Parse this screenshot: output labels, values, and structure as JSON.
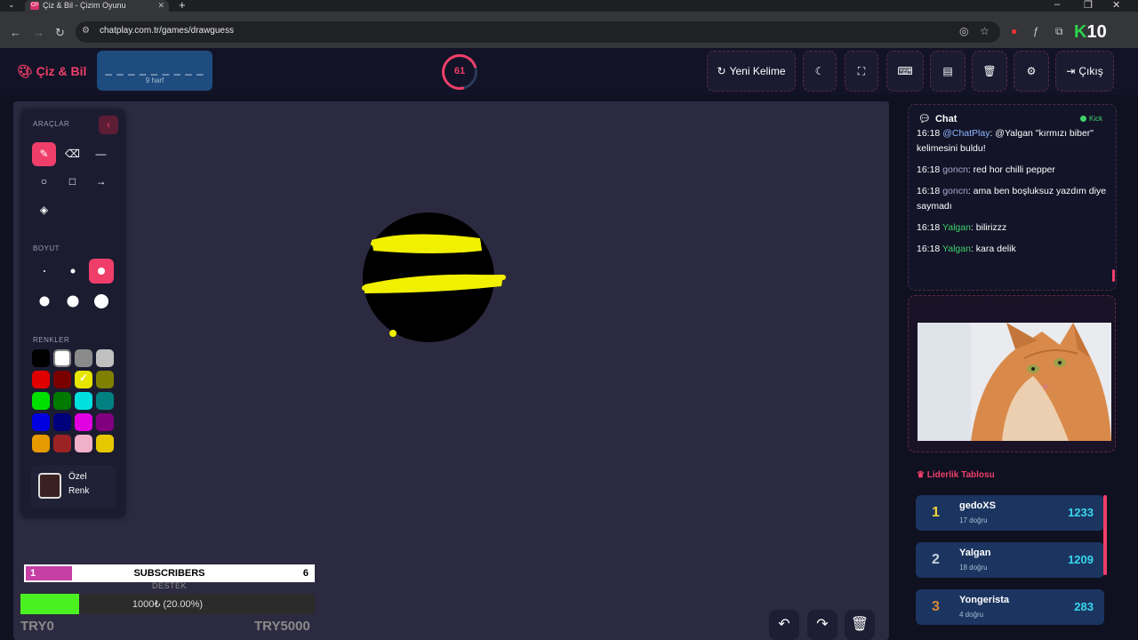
{
  "browser": {
    "tab_title": "Çiz & Bil - Çizim Oyunu",
    "tab_favicon": "CP",
    "url": "chatplay.com.tr/games/drawguess",
    "k10_label": "10",
    "k10_letter": "K"
  },
  "header": {
    "brand": "Çiz & Bil",
    "word_hint": "_ _ _ _ _ _ _ _ _",
    "letter_count": "9 harf",
    "timer": "61",
    "new_word_label": "Yeni Kelime",
    "exit_label": "Çıkış"
  },
  "tools": {
    "section_tools": "ARAÇLAR",
    "section_size": "BOYUT",
    "section_colors": "RENKLER",
    "custom_color_label": "Özel Renk",
    "colors": [
      "#000000",
      "#ffffff",
      "#8a8a8a",
      "#c0c0c0",
      "#e00000",
      "#7a0000",
      "#e6e600",
      "#808000",
      "#00e000",
      "#007a00",
      "#00e0e0",
      "#008080",
      "#0000e0",
      "#00007a",
      "#e000e0",
      "#800080",
      "#e69a00",
      "#9c2323",
      "#f0b0c8",
      "#e6c800"
    ],
    "selected_color": "#e6e600"
  },
  "overlay": {
    "subs_current": "1",
    "subs_label": "SUBSCRIBERS",
    "subs_target": "6",
    "subs_progress": 0.16,
    "destek_label": "DESTEK",
    "donation_text": "1000₺ (20.00%)",
    "donation_progress": 0.2,
    "donation_min": "TRY0",
    "donation_max": "TRY5000"
  },
  "chat": {
    "title": "Chat",
    "status": "Kick",
    "messages": [
      {
        "time": "16:18",
        "user": "@ChatPlay",
        "text": ": @Yalgan \"kırmızı biber\" kelimesini buldu!",
        "style": "u1"
      },
      {
        "time": "16:18",
        "user": "goncn",
        "text": ": red hor chilli pepper",
        "style": "u2"
      },
      {
        "time": "16:18",
        "user": "goncn",
        "text": ": ama ben boşluksuz yazdım diye saymadı",
        "style": "u2"
      },
      {
        "time": "16:18",
        "user": "Yalgan",
        "text": ": bilirizzz",
        "style": "u3"
      },
      {
        "time": "16:18",
        "user": "Yalgan",
        "text": ": kara delik",
        "style": "u3"
      }
    ]
  },
  "leaderboard": {
    "title": "Liderlik Tablosu",
    "rows": [
      {
        "rank": "1",
        "name": "gedoXS",
        "sub": "17 doğru",
        "score": "1233",
        "rank_color": "#f2d23c"
      },
      {
        "rank": "2",
        "name": "Yalgan",
        "sub": "18 doğru",
        "score": "1209",
        "rank_color": "#c7d0dc"
      },
      {
        "rank": "3",
        "name": "Yongerista",
        "sub": "4 doğru",
        "score": "283",
        "rank_color": "#d8893a"
      }
    ]
  }
}
